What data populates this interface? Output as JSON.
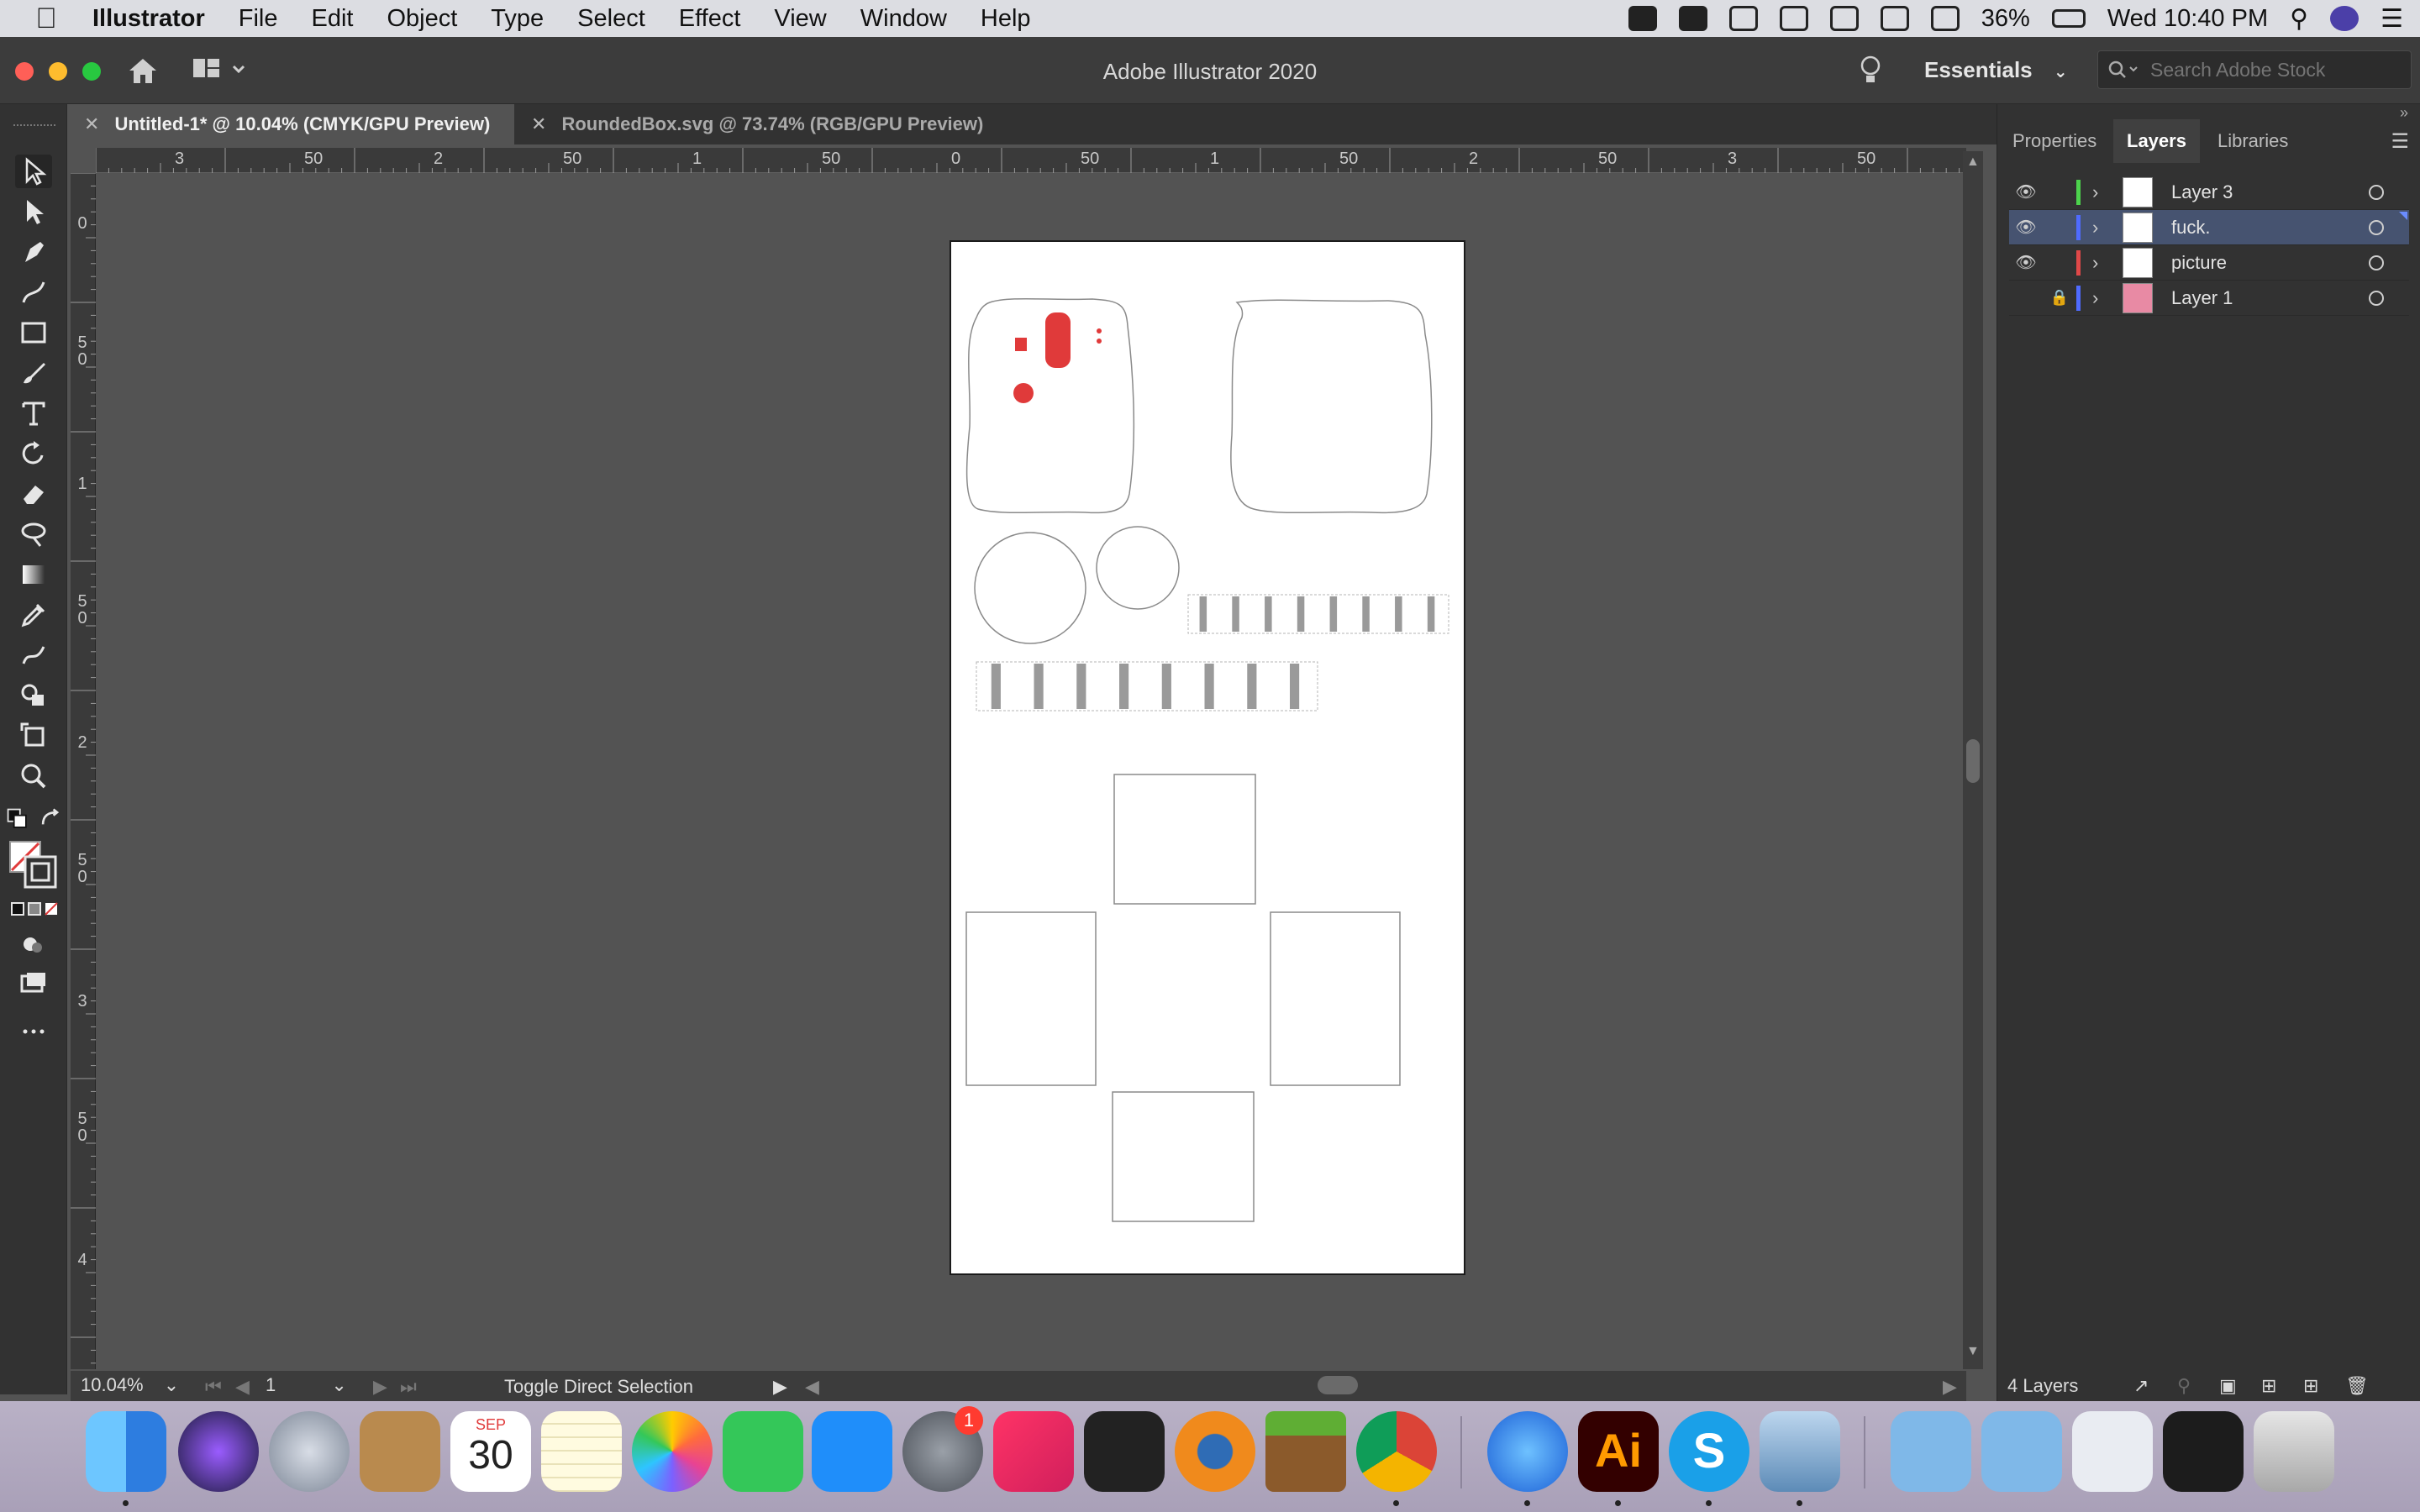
{
  "menubar": {
    "app_name": "Illustrator",
    "menus": [
      "File",
      "Edit",
      "Object",
      "Type",
      "Select",
      "Effect",
      "View",
      "Window",
      "Help"
    ],
    "battery": "36%",
    "clock": "Wed 10:40 PM"
  },
  "titlebar": {
    "window_title": "Adobe Illustrator 2020",
    "workspace": "Essentials",
    "search_placeholder": "Search Adobe Stock"
  },
  "tabs": [
    {
      "label": "Untitled-1* @ 10.04% (CMYK/GPU Preview)",
      "close": "✕"
    },
    {
      "label": "RoundedBox.svg @ 73.74% (RGB/GPU Preview)",
      "close": "✕"
    }
  ],
  "ruler": {
    "top_labels": [
      "3",
      "50",
      "2",
      "50",
      "1",
      "50",
      "0",
      "50",
      "1",
      "50",
      "2",
      "50",
      "3",
      "50"
    ],
    "left_labels": [
      "0",
      "5\n0",
      "1",
      "5\n0",
      "2",
      "5\n0",
      "3",
      "5\n0",
      "4"
    ]
  },
  "statusbar": {
    "zoom": "10.04%",
    "artboard_number": "1",
    "status_text": "Toggle Direct Selection"
  },
  "right_panel": {
    "tabs": [
      "Properties",
      "Layers",
      "Libraries"
    ],
    "active_tab": "Layers",
    "layers": [
      {
        "name": "Layer 3",
        "color": "#4cd34c",
        "visible": true,
        "locked": false,
        "selected": false
      },
      {
        "name": "fuck.",
        "color": "#4f6bff",
        "visible": true,
        "locked": false,
        "selected": true
      },
      {
        "name": "picture",
        "color": "#e04848",
        "visible": true,
        "locked": false,
        "selected": false
      },
      {
        "name": "Layer 1",
        "color": "#4f6bff",
        "visible": false,
        "locked": true,
        "selected": false
      }
    ],
    "footer": "4 Layers"
  },
  "dock": {
    "calendar_month": "SEP",
    "calendar_day": "30",
    "notification_badge": "1",
    "illustrator_label": "Ai",
    "skype_label": "S"
  },
  "colors": {
    "accent_red": "#e03a3a",
    "selection_blue": "#465370"
  }
}
